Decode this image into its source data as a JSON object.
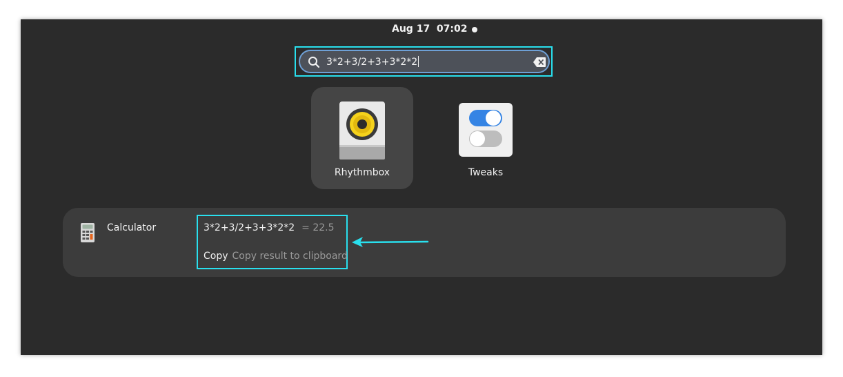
{
  "top_bar": {
    "clock": "Aug 17  07:02"
  },
  "search": {
    "query": "3*2+3/2+3+3*2*2"
  },
  "apps": [
    {
      "label": "Rhythmbox",
      "selected": true
    },
    {
      "label": "Tweaks",
      "selected": false
    }
  ],
  "calculator_result": {
    "provider": "Calculator",
    "expression": "3*2+3/2+3+3*2*2",
    "value": "= 22.5",
    "action_label": "Copy",
    "action_description": "Copy result to clipboard"
  },
  "colors": {
    "annotation": "#29e0ee",
    "background": "#2b2b2b",
    "card": "#3c3c3c",
    "search_focus": "#6ea0d6"
  },
  "icons": {
    "search": "search-icon",
    "clear": "clear-text-icon",
    "rhythmbox": "rhythmbox-speaker-icon",
    "tweaks": "tweaks-toggle-icon",
    "calculator": "calculator-icon"
  }
}
